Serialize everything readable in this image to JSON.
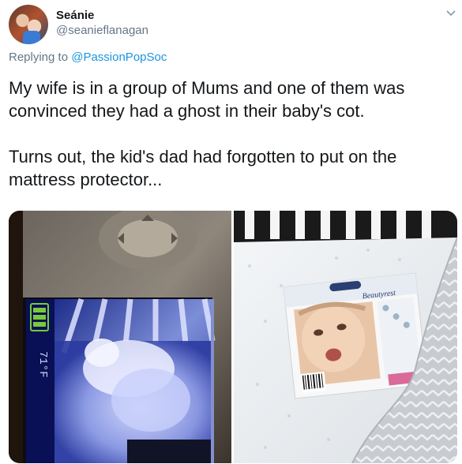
{
  "author": {
    "display_name": "Seánie",
    "handle": "@seanieflanagan"
  },
  "reply": {
    "prefix": "Replying to",
    "mention": "@PassionPopSoc"
  },
  "tweet": {
    "paragraph_1": "My wife is in a group of Mums and one of them was convinced they had a ghost in their baby's cot.",
    "paragraph_2": "Turns out, the kid's dad had forgotten to put on the mattress protector..."
  },
  "media": {
    "monitor_temperature": "71°F",
    "package_brand": "Beautyrest"
  },
  "icons": {
    "caret": "chevron-down-icon",
    "battery": "battery-icon"
  },
  "colors": {
    "text": "#14171a",
    "secondary": "#657786",
    "link": "#1b95e0"
  }
}
